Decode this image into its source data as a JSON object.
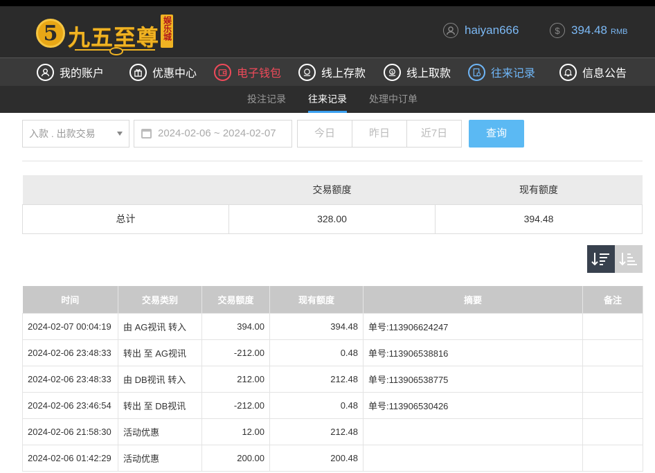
{
  "brand": {
    "logo_char": "5",
    "name": "九五至尊",
    "badge": "娱乐城"
  },
  "account": {
    "username": "haiyan666",
    "balance": "394.48",
    "currency": "RMB"
  },
  "nav": [
    {
      "label": "我的账户",
      "icon": "user-icon"
    },
    {
      "label": "优惠中心",
      "icon": "gift-icon"
    },
    {
      "label": "电子钱包",
      "icon": "wallet-icon"
    },
    {
      "label": "线上存款",
      "icon": "deposit-icon"
    },
    {
      "label": "线上取款",
      "icon": "withdraw-icon"
    },
    {
      "label": "往来记录",
      "icon": "records-icon"
    },
    {
      "label": "信息公告",
      "icon": "bell-icon"
    }
  ],
  "subtabs": [
    {
      "label": "投注记录"
    },
    {
      "label": "往来记录"
    },
    {
      "label": "处理中订单"
    }
  ],
  "filters": {
    "type_value": "入款 . 出款交易",
    "date_range": "2024-02-06 ~ 2024-02-07",
    "today": "今日",
    "yesterday": "昨日",
    "last7": "近7日",
    "query": "查询"
  },
  "summary": {
    "headers": [
      "",
      "交易额度",
      "现有额度"
    ],
    "row": {
      "label": "总计",
      "amount": "328.00",
      "balance": "394.48"
    }
  },
  "records": {
    "headers": [
      "时间",
      "交易类别",
      "交易额度",
      "现有额度",
      "摘要",
      "备注"
    ],
    "rows": [
      [
        "2024-02-07 00:04:19",
        "由 AG视讯 转入",
        "394.00",
        "394.48",
        "单号:113906624247",
        ""
      ],
      [
        "2024-02-06 23:48:33",
        "转出 至 AG视讯",
        "-212.00",
        "0.48",
        "单号:113906538816",
        ""
      ],
      [
        "2024-02-06 23:48:33",
        "由 DB视讯 转入",
        "212.00",
        "212.48",
        "单号:113906538775",
        ""
      ],
      [
        "2024-02-06 23:46:54",
        "转出 至 DB视讯",
        "-212.00",
        "0.48",
        "单号:113906530426",
        ""
      ],
      [
        "2024-02-06 21:58:30",
        "活动优惠",
        "12.00",
        "212.48",
        "",
        ""
      ],
      [
        "2024-02-06 01:42:29",
        "活动优惠",
        "200.00",
        "200.48",
        "",
        ""
      ]
    ]
  },
  "colors": {
    "accent": "#5bb9f3",
    "active_red": "#f04a5a",
    "active_blue": "#6fb6f7",
    "gold": "#f0b323"
  }
}
